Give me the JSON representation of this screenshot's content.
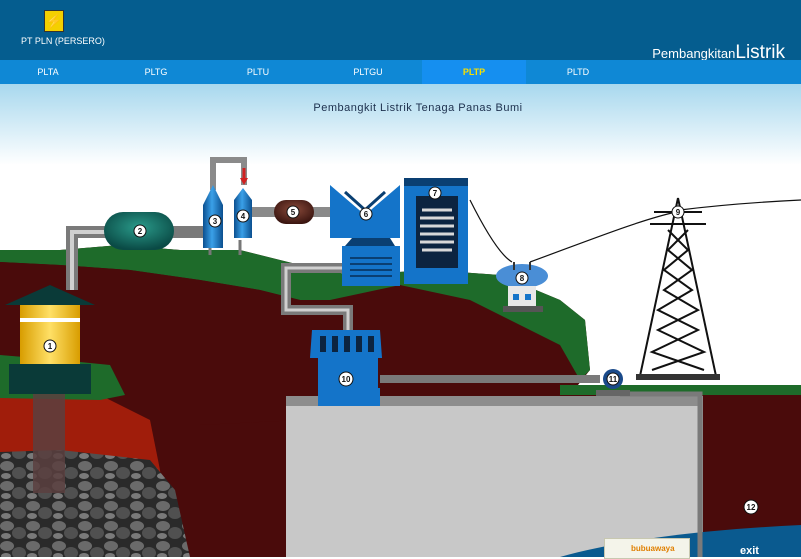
{
  "header": {
    "company": "PT PLN (PERSERO)",
    "title_small": "Pembangkitan",
    "title_big": "Listrik"
  },
  "nav": {
    "tabs": [
      {
        "label": "PLTA"
      },
      {
        "label": "PLTG"
      },
      {
        "label": "PLTU"
      },
      {
        "label": "PLTGU"
      },
      {
        "label": "PLTP",
        "active": true
      },
      {
        "label": "PLTD"
      }
    ]
  },
  "scene": {
    "title": "Pembangkit  Listrik  Tenaga  Panas Bumi",
    "components": [
      {
        "number": "1"
      },
      {
        "number": "2"
      },
      {
        "number": "3"
      },
      {
        "number": "4"
      },
      {
        "number": "5"
      },
      {
        "number": "6"
      },
      {
        "number": "7"
      },
      {
        "number": "8"
      },
      {
        "number": "9"
      },
      {
        "number": "10"
      },
      {
        "number": "11"
      },
      {
        "number": "12"
      }
    ]
  },
  "footer": {
    "exit_label": "exit",
    "badge_text": "bubuawaya"
  },
  "colors": {
    "header_bg": "#055d8f",
    "nav_bg": "#0f88d5",
    "active_tab_text": "#f7e000",
    "machine_blue": "#1474c9",
    "ground_dark": "#4a0b0b",
    "grass": "#1e6b2a"
  }
}
